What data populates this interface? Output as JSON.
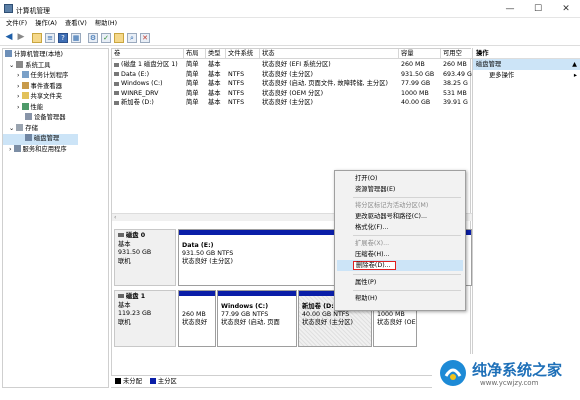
{
  "window": {
    "title": "计算机管理",
    "min": "—",
    "max": "☐",
    "close": "✕"
  },
  "menu": [
    "文件(F)",
    "操作(A)",
    "查看(V)",
    "帮助(H)"
  ],
  "toolbar_icons": [
    "back-arrow-icon",
    "forward-arrow-icon",
    "folder-icon",
    "list-icon",
    "help-icon",
    "properties-icon",
    "settings-icon",
    "check-icon",
    "folder-open-icon",
    "search-icon",
    "delete-icon"
  ],
  "tree": {
    "root": "计算机管理(本地)",
    "system_tools": "系统工具",
    "task_scheduler": "任务计划程序",
    "event_viewer": "事件查看器",
    "shared_folders": "共享文件夹",
    "performance": "性能",
    "device_manager": "设备管理器",
    "storage": "存储",
    "disk_management": "磁盘管理",
    "services": "服务和应用程序"
  },
  "table": {
    "columns": [
      "卷",
      "布局",
      "类型",
      "文件系统",
      "状态",
      "容量",
      "可用空"
    ],
    "rows": [
      {
        "vol": "(磁盘 1 磁盘分区 1)",
        "layout": "简单",
        "type": "基本",
        "fs": "",
        "status": "状态良好 (EFI 系统分区)",
        "cap": "260 MB",
        "free": "260 MB"
      },
      {
        "vol": "Data (E:)",
        "layout": "简单",
        "type": "基本",
        "fs": "NTFS",
        "status": "状态良好 (主分区)",
        "cap": "931.50 GB",
        "free": "693.49 G"
      },
      {
        "vol": "Windows (C:)",
        "layout": "简单",
        "type": "基本",
        "fs": "NTFS",
        "status": "状态良好 (启动, 页面文件, 故障转储, 主分区)",
        "cap": "77.99 GB",
        "free": "38.25 G"
      },
      {
        "vol": "WINRE_DRV",
        "layout": "简单",
        "type": "基本",
        "fs": "NTFS",
        "status": "状态良好 (OEM 分区)",
        "cap": "1000 MB",
        "free": "531 MB"
      },
      {
        "vol": "新加卷 (D:)",
        "layout": "简单",
        "type": "基本",
        "fs": "NTFS",
        "status": "状态良好 (主分区)",
        "cap": "40.00 GB",
        "free": "39.91 G"
      }
    ]
  },
  "disk0": {
    "name": "磁盘 0",
    "type": "基本",
    "size": "931.50 GB",
    "status": "联机",
    "part": {
      "name": "Data (E:)",
      "size": "931.50 GB NTFS",
      "status": "状态良好 (主分区)"
    }
  },
  "disk1": {
    "name": "磁盘 1",
    "type": "基本",
    "size": "119.23 GB",
    "status": "联机",
    "parts": [
      {
        "name": "",
        "size": "260 MB",
        "status": "状态良好"
      },
      {
        "name": "Windows (C:)",
        "size": "77.99 GB NTFS",
        "status": "状态良好 (启动, 页面"
      },
      {
        "name": "新加卷 (D:)",
        "size": "40.00 GB NTFS",
        "status": "状态良好 (主分区)"
      },
      {
        "name": "",
        "size": "1000 MB",
        "status": "状态良好 (OE"
      }
    ]
  },
  "context_menu": {
    "open": "打开(O)",
    "explorer": "资源管理器(E)",
    "mark_active": "将分区标记为活动分区(M)",
    "change_letter": "更改驱动器号和路径(C)...",
    "format": "格式化(F)...",
    "extend": "扩展卷(X)...",
    "shrink": "压缩卷(H)...",
    "delete": "删除卷(D)...",
    "properties": "属性(P)",
    "help": "帮助(H)"
  },
  "actions": {
    "header": "操作",
    "section": "磁盘管理",
    "more": "更多操作"
  },
  "legend": {
    "unallocated": "未分配",
    "primary": "主分区"
  },
  "watermark": {
    "text": "纯净系统之家",
    "url": "www.ycwjzy.com"
  },
  "colors": {
    "primary_band": "#0a1ea8",
    "highlight": "#cce4f7",
    "delete_outline": "#e02020"
  }
}
